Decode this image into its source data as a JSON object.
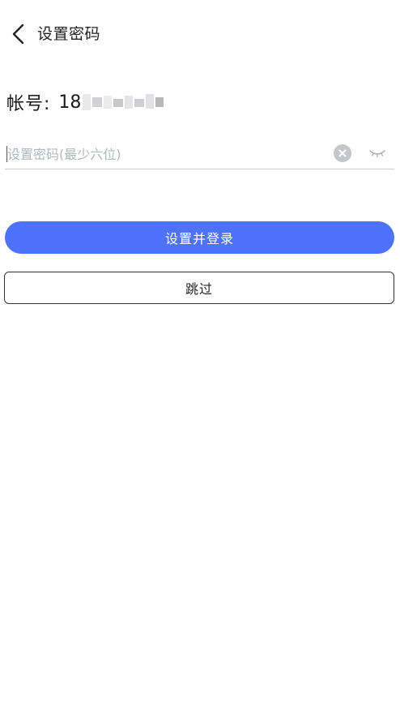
{
  "header": {
    "back_icon": "chevron-left-icon",
    "title": "设置密码"
  },
  "account": {
    "label": "帐号:",
    "visible_prefix": "18",
    "masked": true
  },
  "password_field": {
    "value": "",
    "placeholder": "设置密码(最少六位)",
    "clear_icon": "clear-circle-icon",
    "visibility_icon": "eye-closed-icon"
  },
  "actions": {
    "submit_label": "设置并登录",
    "skip_label": "跳过"
  },
  "colors": {
    "primary": "#4e72fc",
    "placeholder": "#b3b6bf",
    "divider": "#c9ccd8",
    "clear_icon_bg": "#c4c6cc"
  }
}
